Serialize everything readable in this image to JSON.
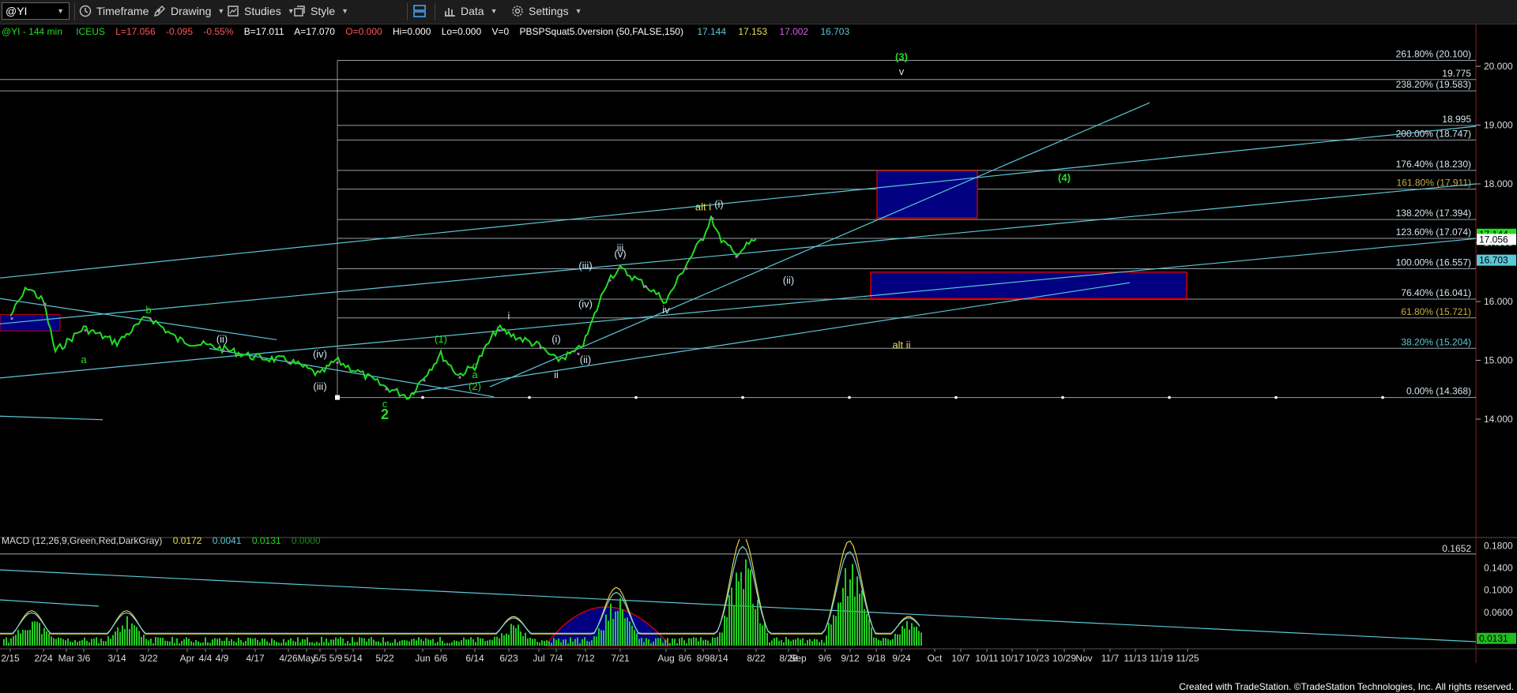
{
  "toolbar": {
    "symbol": "@YI",
    "timeframe": "Timeframe",
    "drawing": "Drawing",
    "studies": "Studies",
    "style": "Style",
    "data": "Data",
    "settings": "Settings"
  },
  "legend": {
    "symbol": "@YI - 144 min",
    "exchange": "ICEUS",
    "last": "L=17.056",
    "change": "-0.095",
    "pct": "-0.55%",
    "bid": "B=17.011",
    "ask": "A=17.070",
    "open": "O=0.000",
    "high": "Hi=0.000",
    "low": "Lo=0.000",
    "volume": "V=0",
    "study": "PBSPSquat5.0version (50,FALSE,150)",
    "study_vals": [
      "17.144",
      "17.153",
      "17.002",
      "16.703"
    ]
  },
  "macd_legend": {
    "label": "MACD (12,26,9,Green,Red,DarkGray)",
    "vals": [
      "0.0172",
      "0.0041",
      "0.0131",
      "0.0000"
    ]
  },
  "footer": "Created with TradeStation. ©TradeStation Technologies, Inc. All rights reserved.",
  "colors": {
    "price_up": "#22dd22",
    "trendline": "#5bc8d8",
    "fib_line": "#c8d4dc",
    "box_fill": "#000080",
    "box_border": "#cc0000",
    "wave_green": "#22dd22",
    "wave_white": "#d0e4f0",
    "wave_yellow": "#e6e050",
    "macd_hist": "#22cc22",
    "macd_line_a": "#e8d040",
    "macd_line_b": "#7fd0e0"
  },
  "chart_data": {
    "type": "line",
    "title": "",
    "ylim": [
      13.6,
      20.35
    ],
    "y_ticks": [
      "20.000",
      "19.000",
      "18.000",
      "17.000",
      "16.000",
      "15.000",
      "14.000"
    ],
    "x_tick_labels": [
      "2/15",
      "2/24",
      "Mar",
      "3/6",
      "3/14",
      "3/22",
      "Apr",
      "4/4",
      "4/9",
      "4/17",
      "4/26",
      "May",
      "5/5",
      "5/9",
      "5/14",
      "5/22",
      "Jun",
      "6/6",
      "6/14",
      "6/23",
      "Jul",
      "7/4",
      "7/12",
      "7/21",
      "Aug",
      "8/6",
      "8/9",
      "8/14",
      "8/22",
      "8/28",
      "Sep",
      "9/6",
      "9/12",
      "9/18",
      "9/24",
      "Oct",
      "10/7",
      "10/11",
      "10/17",
      "10/23",
      "10/29",
      "Nov",
      "11/7",
      "11/13",
      "11/19",
      "11/25"
    ],
    "fib_levels": [
      {
        "label": "261.80% (20.100)",
        "value": 20.1
      },
      {
        "label": "19.775",
        "value": 19.775
      },
      {
        "label": "238.20% (19.583)",
        "value": 19.583
      },
      {
        "label": "18.995",
        "value": 18.995
      },
      {
        "label": "200.00% (18.747)",
        "value": 18.747
      },
      {
        "label": "176.40% (18.230)",
        "value": 18.23
      },
      {
        "label": "161.80% (17.911)",
        "value": 17.911
      },
      {
        "label": "138.20% (17.394)",
        "value": 17.394
      },
      {
        "label": "123.60% (17.074)",
        "value": 17.074
      },
      {
        "label": "100.00% (16.557)",
        "value": 16.557
      },
      {
        "label": "76.40% (16.041)",
        "value": 16.041
      },
      {
        "label": "61.80% (15.721)",
        "value": 15.721
      },
      {
        "label": "38.20% (15.204)",
        "value": 15.204
      },
      {
        "label": "0.00% (14.368)",
        "value": 14.368
      }
    ],
    "price_tags": [
      {
        "text": "17.144",
        "value": 17.144,
        "color": "#22dd22"
      },
      {
        "text": "17.056",
        "value": 17.056,
        "color": "#ffffff"
      },
      {
        "text": "16.703",
        "value": 16.703,
        "color": "#5bc8d8"
      }
    ],
    "price_series": [
      {
        "x": "2/15",
        "y": 15.75
      },
      {
        "x": "2/20",
        "y": 16.25
      },
      {
        "x": "2/24",
        "y": 16.0
      },
      {
        "x": "3/1",
        "y": 15.15
      },
      {
        "x": "3/6",
        "y": 15.55
      },
      {
        "x": "3/14",
        "y": 15.3
      },
      {
        "x": "3/22",
        "y": 15.75
      },
      {
        "x": "4/1",
        "y": 15.35
      },
      {
        "x": "4/9",
        "y": 15.2
      },
      {
        "x": "4/17",
        "y": 15.05
      },
      {
        "x": "4/26",
        "y": 15.0
      },
      {
        "x": "5/5",
        "y": 14.75
      },
      {
        "x": "5/9",
        "y": 15.0
      },
      {
        "x": "5/14",
        "y": 14.85
      },
      {
        "x": "5/22",
        "y": 14.55
      },
      {
        "x": "5/28",
        "y": 14.38
      },
      {
        "x": "Jun",
        "y": 14.7
      },
      {
        "x": "6/6",
        "y": 15.1
      },
      {
        "x": "6/10",
        "y": 14.75
      },
      {
        "x": "6/14",
        "y": 14.9
      },
      {
        "x": "6/20",
        "y": 15.55
      },
      {
        "x": "6/23",
        "y": 15.45
      },
      {
        "x": "Jul",
        "y": 15.25
      },
      {
        "x": "7/4",
        "y": 15.0
      },
      {
        "x": "7/10",
        "y": 15.15
      },
      {
        "x": "7/12",
        "y": 15.35
      },
      {
        "x": "7/18",
        "y": 16.4
      },
      {
        "x": "7/21",
        "y": 16.55
      },
      {
        "x": "7/28",
        "y": 16.3
      },
      {
        "x": "Aug",
        "y": 16.0
      },
      {
        "x": "8/6",
        "y": 16.6
      },
      {
        "x": "8/9",
        "y": 17.1
      },
      {
        "x": "8/12",
        "y": 17.45
      },
      {
        "x": "8/14",
        "y": 17.1
      },
      {
        "x": "8/18",
        "y": 16.8
      },
      {
        "x": "8/22",
        "y": 17.06
      }
    ],
    "wave_labels": [
      {
        "text": "(3)",
        "x": "9/24",
        "y": 20.1,
        "color": "green"
      },
      {
        "text": "v",
        "x": "9/24",
        "y": 19.85,
        "color": "white"
      },
      {
        "text": "(4)",
        "x": "10/29",
        "y": 18.05,
        "color": "green"
      },
      {
        "text": "alt i",
        "x": "8/9",
        "y": 17.55,
        "color": "yellow"
      },
      {
        "text": "(i)",
        "x": "8/14",
        "y": 17.6,
        "color": "white"
      },
      {
        "text": "(ii)",
        "x": "8/28",
        "y": 16.3,
        "color": "white"
      },
      {
        "text": "iii",
        "x": "7/21",
        "y": 16.85,
        "color": "white"
      },
      {
        "text": "(v)",
        "x": "7/21",
        "y": 16.75,
        "color": "white"
      },
      {
        "text": "(iii)",
        "x": "7/12",
        "y": 16.55,
        "color": "white"
      },
      {
        "text": "(iv)",
        "x": "7/12",
        "y": 15.9,
        "color": "white"
      },
      {
        "text": "iv",
        "x": "Aug",
        "y": 15.8,
        "color": "white"
      },
      {
        "text": "alt ii",
        "x": "9/24",
        "y": 15.2,
        "color": "yellow"
      },
      {
        "text": "i",
        "x": "6/23",
        "y": 15.7,
        "color": "white"
      },
      {
        "text": "(i)",
        "x": "7/4",
        "y": 15.3,
        "color": "white"
      },
      {
        "text": "(ii)",
        "x": "7/12",
        "y": 14.95,
        "color": "white"
      },
      {
        "text": "ii",
        "x": "7/4",
        "y": 14.7,
        "color": "white"
      },
      {
        "text": "(1)",
        "x": "6/6",
        "y": 15.3,
        "color": "green"
      },
      {
        "text": "a",
        "x": "6/14",
        "y": 14.7,
        "color": "green"
      },
      {
        "text": "c",
        "x": "6/14",
        "y": 14.85,
        "color": "green"
      },
      {
        "text": "(2)",
        "x": "6/14",
        "y": 14.5,
        "color": "green"
      },
      {
        "text": "c",
        "x": "5/22",
        "y": 14.2,
        "color": "green"
      },
      {
        "text": "2",
        "x": "5/22",
        "y": 14.0,
        "color": "green"
      },
      {
        "text": "a",
        "x": "3/6",
        "y": 14.95,
        "color": "green"
      },
      {
        "text": "b",
        "x": "3/22",
        "y": 15.8,
        "color": "green"
      },
      {
        "text": "(ii)",
        "x": "4/9",
        "y": 15.3,
        "color": "white"
      },
      {
        "text": "(iv)",
        "x": "5/5",
        "y": 15.05,
        "color": "white"
      },
      {
        "text": "(iii)",
        "x": "5/5",
        "y": 14.5,
        "color": "white"
      }
    ],
    "macd": {
      "ylim": [
        0,
        0.195
      ],
      "y_ticks": [
        "0.1800",
        "0.1400",
        "0.1000",
        "0.0600"
      ],
      "level_label": "0.1652",
      "last": "0.0131"
    }
  }
}
